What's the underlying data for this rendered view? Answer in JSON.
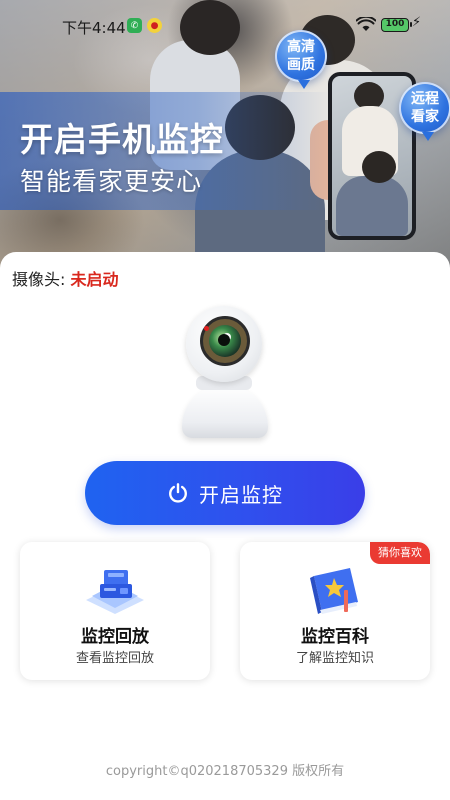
{
  "status_bar": {
    "time": "下午4:44",
    "battery": "100"
  },
  "hero": {
    "title": "开启手机监控",
    "subtitle": "智能看家更安心",
    "badge_hd": "高清画质",
    "badge_remote": "远程看家"
  },
  "camera_status": {
    "label": "摄像头: ",
    "value": "未启动"
  },
  "start_button": {
    "label": "开启监控"
  },
  "cards": [
    {
      "title": "监控回放",
      "subtitle": "查看监控回放",
      "icon": "playback-device-icon"
    },
    {
      "title": "监控百科",
      "subtitle": "了解监控知识",
      "icon": "encyclopedia-book-icon",
      "tag": "猜你喜欢"
    }
  ],
  "footer": {
    "copyright": "copyright©q020218705329 版权所有"
  },
  "colors": {
    "primary": "#2f5bef",
    "status_red": "#d9281e",
    "tag_red": "#ea3a32"
  }
}
